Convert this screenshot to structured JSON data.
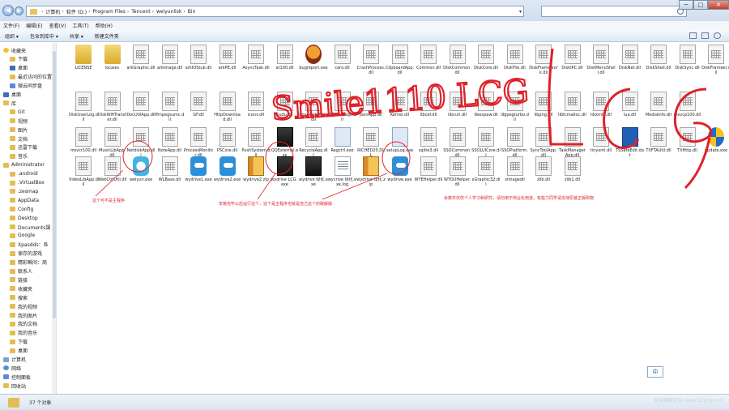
{
  "address": {
    "crumbs": [
      "计算机",
      "软件 (D:)",
      "Program Files",
      "Tencent",
      "weiyunlisk",
      "Bin"
    ]
  },
  "menu": [
    "文件(F)",
    "编辑(E)",
    "查看(V)",
    "工具(T)",
    "帮助(H)"
  ],
  "toolbar": [
    "组织 ▾",
    "包含到库中 ▾",
    "共享 ▾",
    "新建文件夹"
  ],
  "nav": [
    {
      "label": "收藏夹",
      "icon": "star",
      "indent": 0
    },
    {
      "label": "下载",
      "icon": "fold",
      "indent": 1
    },
    {
      "label": "桌面",
      "icon": "desk",
      "indent": 1
    },
    {
      "label": "最近访问的位置",
      "icon": "fold",
      "indent": 1
    },
    {
      "label": "微云同步盘",
      "icon": "blue",
      "indent": 1
    },
    {
      "label": "桌面",
      "icon": "desk",
      "indent": 0
    },
    {
      "label": "库",
      "icon": "fold",
      "indent": 0
    },
    {
      "label": "Git",
      "icon": "fold",
      "indent": 1
    },
    {
      "label": "视频",
      "icon": "fold",
      "indent": 1
    },
    {
      "label": "图片",
      "icon": "fold",
      "indent": 1
    },
    {
      "label": "文档",
      "icon": "fold",
      "indent": 1
    },
    {
      "label": "迅雷下载",
      "icon": "fold",
      "indent": 1
    },
    {
      "label": "音乐",
      "icon": "fold",
      "indent": 1
    },
    {
      "label": "Administrator",
      "icon": "fold",
      "indent": 0
    },
    {
      "label": ".android",
      "icon": "fold",
      "indent": 1
    },
    {
      "label": ".VirtualBox",
      "icon": "fold",
      "indent": 1
    },
    {
      "label": ".zesmap",
      "icon": "fold",
      "indent": 1
    },
    {
      "label": "AppData",
      "icon": "fold",
      "indent": 1
    },
    {
      "label": "Config",
      "icon": "fold",
      "indent": 1
    },
    {
      "label": "Desktop",
      "icon": "fold",
      "indent": 1
    },
    {
      "label": "Documents课",
      "icon": "fold",
      "indent": 1
    },
    {
      "label": "Google",
      "icon": "fold",
      "indent": 1
    },
    {
      "label": "Xpasdds：各",
      "icon": "fold",
      "indent": 1
    },
    {
      "label": "保存的游戏",
      "icon": "fold",
      "indent": 1
    },
    {
      "label": "精彩瞬间：商",
      "icon": "fold",
      "indent": 1
    },
    {
      "label": "联系人",
      "icon": "fold",
      "indent": 1
    },
    {
      "label": "链接",
      "icon": "fold",
      "indent": 1
    },
    {
      "label": "收藏夹",
      "icon": "fold",
      "indent": 1
    },
    {
      "label": "搜索",
      "icon": "fold",
      "indent": 1
    },
    {
      "label": "我的视频",
      "icon": "fold",
      "indent": 1
    },
    {
      "label": "我的图片",
      "icon": "fold",
      "indent": 1
    },
    {
      "label": "我的文档",
      "icon": "fold",
      "indent": 1
    },
    {
      "label": "我的音乐",
      "icon": "fold",
      "indent": 1
    },
    {
      "label": "下载",
      "icon": "fold",
      "indent": 1
    },
    {
      "label": "桌面",
      "icon": "fold",
      "indent": 1
    },
    {
      "label": "计算机",
      "icon": "pc",
      "indent": 0
    },
    {
      "label": "网络",
      "icon": "net",
      "indent": 0
    },
    {
      "label": "控制面板",
      "icon": "blue",
      "indent": 0
    },
    {
      "label": "回收站",
      "icon": "fold",
      "indent": 0
    }
  ],
  "files": [
    [
      {
        "name": "LICENSE",
        "icon": "folder"
      },
      {
        "name": "locales",
        "icon": "folder"
      },
      {
        "name": "arkGraphic.dll",
        "icon": "dll"
      },
      {
        "name": "arkImage.dll",
        "icon": "dll"
      },
      {
        "name": "arkIOStub.dll",
        "icon": "dll"
      },
      {
        "name": "arkPE.dll",
        "icon": "dll"
      },
      {
        "name": "AsyncTask.dll",
        "icon": "dll"
      },
      {
        "name": "at100.dll",
        "icon": "dll"
      },
      {
        "name": "bugreport.exe",
        "icon": "bug"
      },
      {
        "name": "caro.dll",
        "icon": "dll"
      },
      {
        "name": "CrashProcess.dll",
        "icon": "dll"
      },
      {
        "name": "ClipboardApp.dll",
        "icon": "dll"
      },
      {
        "name": "Common.dll",
        "icon": "dll"
      },
      {
        "name": "DiskCommon.dll",
        "icon": "dll"
      },
      {
        "name": "DiskCore.dll",
        "icon": "dll"
      },
      {
        "name": "DiskFile.dll",
        "icon": "dll"
      },
      {
        "name": "DiskFramework.dll",
        "icon": "dll"
      },
      {
        "name": "DiskIPC.dll",
        "icon": "dll"
      },
      {
        "name": "DiskMenuShell.dll",
        "icon": "dll"
      },
      {
        "name": "DiskNet.dll",
        "icon": "dll"
      },
      {
        "name": "DiskShell.dll",
        "icon": "dll"
      },
      {
        "name": "DiskSync.dll",
        "icon": "dll"
      },
      {
        "name": "DiskFrameer.dll",
        "icon": "dll"
      }
    ],
    [
      {
        "name": "DiskUserLog.dll",
        "icon": "dll"
      },
      {
        "name": "DiskWifiTransfer.dll",
        "icon": "dll"
      },
      {
        "name": "DocUtilApp.dll",
        "icon": "dll"
      },
      {
        "name": "ffmpegsumc.dll",
        "icon": "dll"
      },
      {
        "name": "GF.dll",
        "icon": "dll"
      },
      {
        "name": "HttpDownload.dll",
        "icon": "dll"
      },
      {
        "name": "iconv.dll",
        "icon": "dll"
      },
      {
        "name": "kudu.dll",
        "icon": "dll"
      },
      {
        "name": "ImageUtilApp.dll",
        "icon": "dll"
      },
      {
        "name": "IPCMessage.dll",
        "icon": "dll"
      },
      {
        "name": "JsonApp.dll",
        "icon": "dll"
      },
      {
        "name": "Kernel.dll",
        "icon": "dll"
      },
      {
        "name": "libcef.dll",
        "icon": "dll"
      },
      {
        "name": "libcurl.dll",
        "icon": "dll"
      },
      {
        "name": "libexpaw.dll",
        "icon": "dll"
      },
      {
        "name": "libjpegturbo.dll",
        "icon": "dll"
      },
      {
        "name": "libpng.dll",
        "icon": "dll"
      },
      {
        "name": "libtcmalloc.dll",
        "icon": "dll"
      },
      {
        "name": "libxml2.dll",
        "icon": "dll"
      },
      {
        "name": "lua.dll",
        "icon": "dll"
      },
      {
        "name": "MediaInfo.dll",
        "icon": "dll"
      },
      {
        "name": "msvcp100.dll",
        "icon": "dll"
      }
    ],
    [
      {
        "name": "msvcr100.dll",
        "icon": "dll"
      },
      {
        "name": "MusicLibApp.dll",
        "icon": "dll"
      },
      {
        "name": "NetdiskApp.dll",
        "icon": "dll"
      },
      {
        "name": "NoteApp.dll",
        "icon": "dll"
      },
      {
        "name": "ProcessMonitor.dll",
        "icon": "dll"
      },
      {
        "name": "PSCore.dll",
        "icon": "dll"
      },
      {
        "name": "PushSystem.dll",
        "icon": "dll"
      },
      {
        "name": "QQExternal.exe",
        "icon": "dark"
      },
      {
        "name": "RecycleApp.dll",
        "icon": "dll"
      },
      {
        "name": "Regctrl.exe",
        "icon": "exe"
      },
      {
        "name": "RICHED20.DLL",
        "icon": "dll"
      },
      {
        "name": "setupLog.exe",
        "icon": "exe"
      },
      {
        "name": "sqlite3.dll",
        "icon": "dll"
      },
      {
        "name": "SSOCommon.dll",
        "icon": "dll"
      },
      {
        "name": "SSOLUICore.dll",
        "icon": "dll"
      },
      {
        "name": "SSOPlatform.dll",
        "icon": "dll"
      },
      {
        "name": "SyncToolApp.dll",
        "icon": "dll"
      },
      {
        "name": "TaskManagerApp.dll",
        "icon": "dll"
      },
      {
        "name": "tinyxml.dll",
        "icon": "dll"
      },
      {
        "name": "TSSafeEdit.dat",
        "icon": "tv"
      },
      {
        "name": "TXFTAUtil.dll",
        "icon": "dll"
      },
      {
        "name": "TXHttp.dll",
        "icon": "dll"
      },
      {
        "name": "update.exe",
        "icon": "shield"
      }
    ],
    [
      {
        "name": "VideoLibApp.dll",
        "icon": "dll"
      },
      {
        "name": "WebCtrlUtil.dll",
        "icon": "dll"
      },
      {
        "name": "weiyun.exe",
        "icon": "cloud"
      },
      {
        "name": "WLBase.dll",
        "icon": "dll"
      },
      {
        "name": "wydrive1.exe",
        "icon": "cloud2"
      },
      {
        "name": "wydrive2.exe",
        "icon": "cloud2"
      },
      {
        "name": "wydrive2.zip",
        "icon": "zip"
      },
      {
        "name": "wydrive LCG .exe",
        "icon": "dark"
      },
      {
        "name": "wydrive 绿化.exe",
        "icon": "dark"
      },
      {
        "name": "wycrive 绿化.exe.log",
        "icon": "log"
      },
      {
        "name": "wydrive 绿化.zip",
        "icon": "zip"
      },
      {
        "name": "wydrive.exe",
        "icon": "cloud2"
      },
      {
        "name": "WYEHelper.dll",
        "icon": "dll"
      },
      {
        "name": "WYOUHelper.dll",
        "icon": "dll"
      },
      {
        "name": "xGraphic32.dll",
        "icon": "dll"
      },
      {
        "name": "xImagedll",
        "icon": "dll"
      },
      {
        "name": "zlib.dll",
        "icon": "dll"
      },
      {
        "name": "zlib1.dll",
        "icon": "dll"
      }
    ]
  ],
  "annotations": {
    "note1": "这个可不是主程序",
    "note2": "安装完毕以后运行这个，这个是主程序也就是自己这个的破解版",
    "note3": "余数件仅供个人学习和研究，请勿用于商业化用途，有能力同学请支持原装正版购物",
    "handwriting": "Smile1110 LCG",
    "color": "#e0202a"
  },
  "status": {
    "count": "37 个对象",
    "watermark": "吾爱破解论坛 www.52pojie.cn"
  },
  "ime": "中",
  "window_controls": [
    "─",
    "□",
    "✕"
  ],
  "nav_buttons": [
    "◀",
    "▶"
  ],
  "addr_dropdown": "▾"
}
